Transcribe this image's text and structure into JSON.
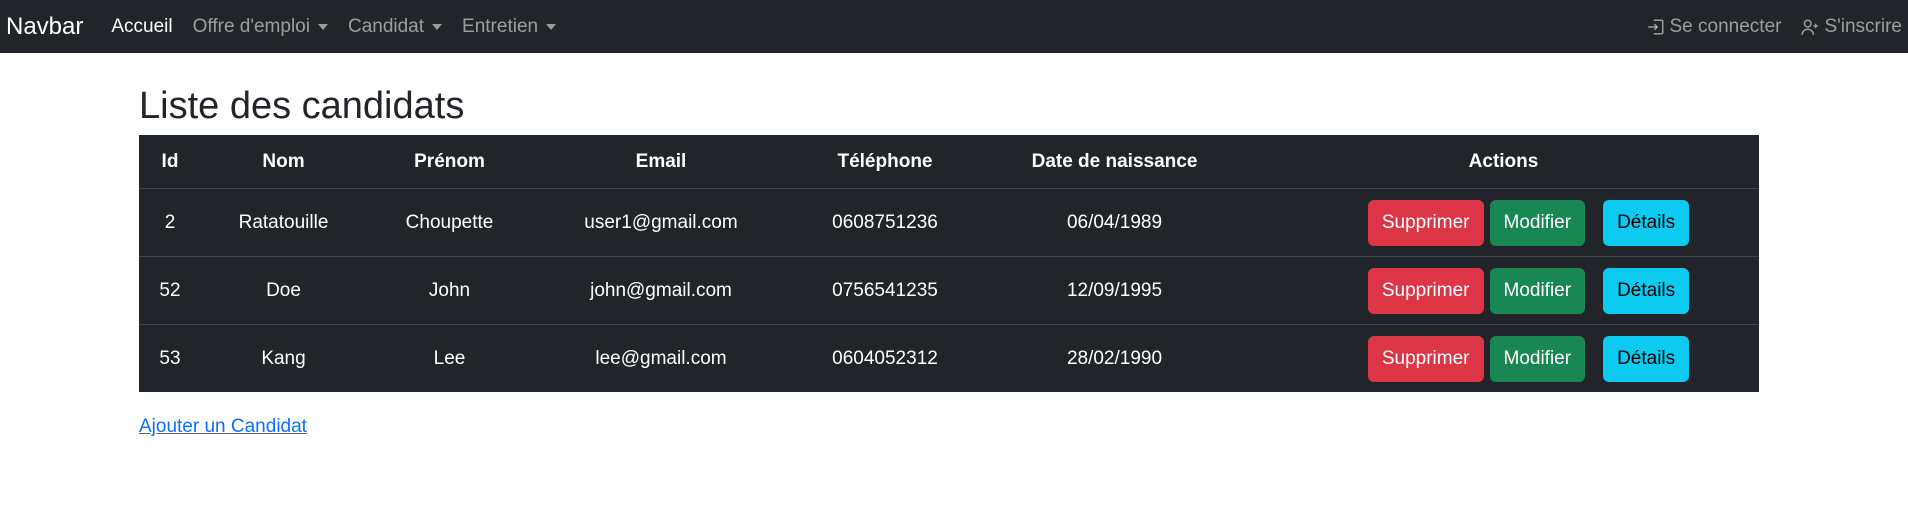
{
  "navbar": {
    "brand": "Navbar",
    "links": [
      {
        "label": "Accueil"
      },
      {
        "label": "Offre d'emploi"
      },
      {
        "label": "Candidat"
      },
      {
        "label": "Entretien"
      }
    ],
    "login_label": "Se connecter",
    "signup_label": "S'inscrire"
  },
  "page": {
    "title": "Liste des candidats",
    "add_link": "Ajouter un Candidat"
  },
  "table": {
    "headers": [
      "Id",
      "Nom",
      "Prénom",
      "Email",
      "Téléphone",
      "Date de naissance",
      "Actions"
    ],
    "rows": [
      {
        "id": "2",
        "nom": "Ratatouille",
        "prenom": "Choupette",
        "email": "user1@gmail.com",
        "telephone": "0608751236",
        "naissance": "06/04/1989"
      },
      {
        "id": "52",
        "nom": "Doe",
        "prenom": "John",
        "email": "john@gmail.com",
        "telephone": "0756541235",
        "naissance": "12/09/1995"
      },
      {
        "id": "53",
        "nom": "Kang",
        "prenom": "Lee",
        "email": "lee@gmail.com",
        "telephone": "0604052312",
        "naissance": "28/02/1990"
      }
    ],
    "actions": {
      "delete_label": "Supprimer",
      "edit_label": "Modifier",
      "details_label": "Détails"
    }
  },
  "colors": {
    "navbar_bg": "#212529",
    "danger": "#dc3545",
    "success": "#198754",
    "info": "#0dcaf0",
    "link": "#0d6efd"
  }
}
